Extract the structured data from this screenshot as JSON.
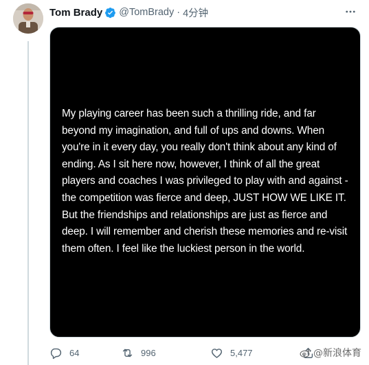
{
  "author": {
    "display_name": "Tom Brady",
    "handle": "@TomBrady",
    "separator": "·",
    "time": "4分钟",
    "avatar": "avatar-photo",
    "verified_icon": "verified-badge-icon"
  },
  "more_icon": "more-options-icon",
  "media": {
    "background": "#000000",
    "text_color": "#ffffff",
    "lines": [
      "My playing career has been such a thrilling ride, and far",
      "beyond my imagination, and full of ups and downs.  When",
      "you're in it every day, you really don't think about any kind of",
      "ending.  As I sit here now, however, I think of all the great",
      "players and coaches I was privileged to play with and against -",
      "the competition was fierce and deep, JUST HOW WE LIKE IT.",
      "But the friendships and relationships are just as fierce and",
      "deep.  I will remember and cherish these memories and re-visit",
      "them often. I feel like the luckiest person in the world."
    ]
  },
  "actions": {
    "reply": {
      "icon": "reply-icon",
      "count": "64"
    },
    "retweet": {
      "icon": "retweet-icon",
      "count": "996"
    },
    "like": {
      "icon": "heart-icon",
      "count": "5,477"
    },
    "share": {
      "icon": "share-icon"
    }
  },
  "watermark": {
    "icon": "weibo-logo-icon",
    "text": "@新浪体育"
  },
  "colors": {
    "verified_blue": "#1d9bf0",
    "secondary_text": "#536471",
    "thread_line": "#cfd9de"
  }
}
